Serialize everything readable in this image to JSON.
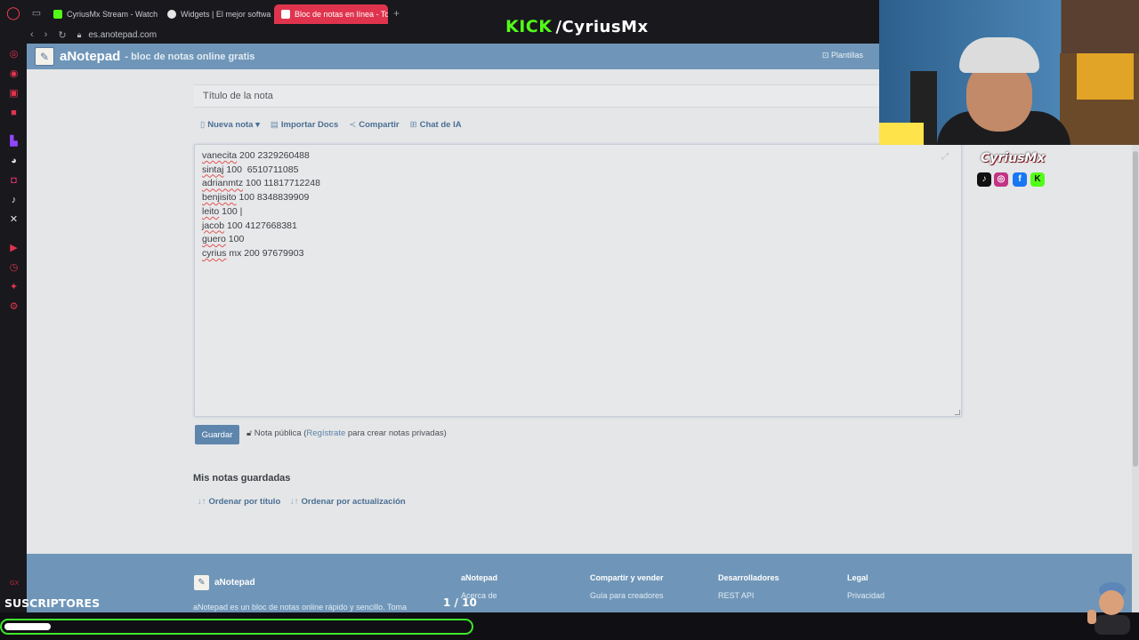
{
  "browser": {
    "tabs": [
      {
        "label": "CyriusMx Stream - Watch",
        "active": false,
        "icon_color": "#53fc18"
      },
      {
        "label": "Widgets | El mejor softwa",
        "active": false,
        "icon_color": "#e6e6e6"
      },
      {
        "label": "Bloc de notas en línea - To",
        "active": true,
        "icon_color": "#ffffff"
      }
    ],
    "url": "es.anotepad.com"
  },
  "site": {
    "name": "aNotepad",
    "tagline": "- bloc de notas online gratis",
    "templates": "Plantillas"
  },
  "note": {
    "title_placeholder": "Título de la nota",
    "toolbar": {
      "new_note": "Nueva nota",
      "import_docs": "Importar Docs",
      "share": "Compartir",
      "ai_chat": "Chat de IA"
    },
    "lines": [
      {
        "name": "vanecita",
        "rest": " 200 2329260488"
      },
      {
        "name": "sintaj",
        "rest": " 100  6510711085"
      },
      {
        "name": "adrianmtz",
        "rest": " 100 11817712248"
      },
      {
        "name": "benjisito",
        "rest": " 100 8348839909"
      },
      {
        "name": "leito",
        "rest": " 100 |"
      },
      {
        "name": "jacob",
        "rest": " 100 4127668381"
      },
      {
        "name": "guero",
        "rest": " 100"
      },
      {
        "name": "cyrius",
        "rest": " mx 200 97679903"
      }
    ],
    "save_label": "Guardar",
    "public_text": "Nota pública (",
    "register_link": "Regístrate",
    "public_suffix": " para crear notas privadas)"
  },
  "saved": {
    "title": "Mis notas guardadas",
    "sort_title": "Ordenar por título",
    "sort_updated": "Ordenar por actualización"
  },
  "footer": {
    "name": "aNotepad",
    "description": "aNotepad es un bloc de notas online rápido y sencillo. Toma",
    "columns": [
      {
        "heading": "aNotepad",
        "link": "Acerca de"
      },
      {
        "heading": "Compartir y vender",
        "link": "Guía para creadores"
      },
      {
        "heading": "Desarrolladores",
        "link": "REST API"
      },
      {
        "heading": "Legal",
        "link": "Privacidad"
      }
    ]
  },
  "stream": {
    "kick_word": "KICK",
    "channel": "/CyriusMx",
    "brand": "CyriusMx",
    "subs_label": "SUSCRIPTORES",
    "subs_count": "1 / 10",
    "subs_progress": 0.1,
    "accent": "#53fc18"
  },
  "icons": {
    "opera": "opera-logo-icon",
    "lock": "lock-icon",
    "notepad": "notepad-icon"
  }
}
